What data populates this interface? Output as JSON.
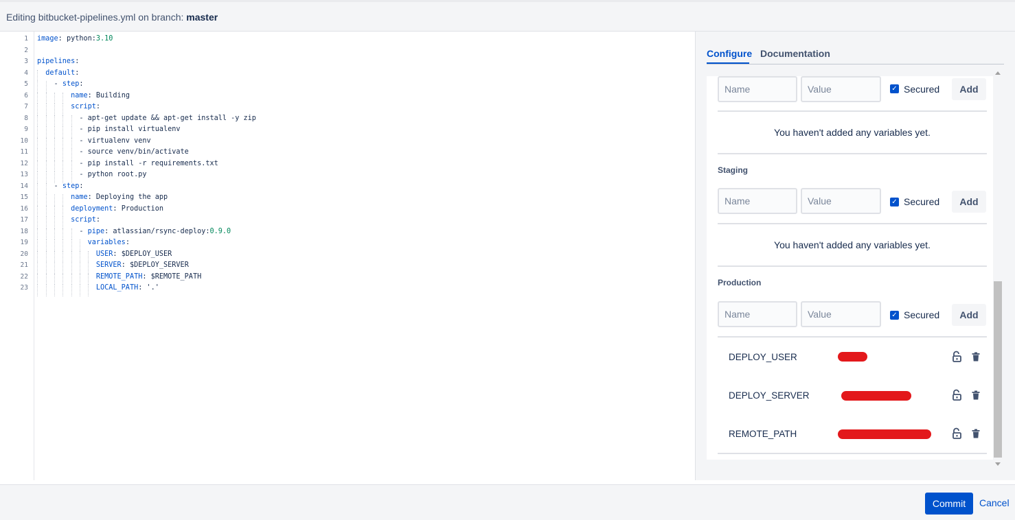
{
  "header": {
    "prefix": "Editing bitbucket-pipelines.yml on branch: ",
    "branch": "master"
  },
  "editor": {
    "lines": [
      "image: python:3.10",
      "",
      "pipelines:",
      "  default:",
      "    - step:",
      "        name: Building",
      "        script:",
      "          - apt-get update && apt-get install -y zip",
      "          - pip install virtualenv",
      "          - virtualenv venv",
      "          - source venv/bin/activate",
      "          - pip install -r requirements.txt",
      "          - python root.py",
      "    - step:",
      "        name: Deploying the app",
      "        deployment: Production",
      "        script:",
      "          - pipe: atlassian/rsync-deploy:0.9.0",
      "            variables:",
      "              USER: $DEPLOY_USER",
      "              SERVER: $DEPLOY_SERVER",
      "              REMOTE_PATH: $REMOTE_PATH",
      "              LOCAL_PATH: '.'"
    ]
  },
  "panel": {
    "tabs": {
      "configure": "Configure",
      "documentation": "Documentation"
    },
    "form": {
      "name_placeholder": "Name",
      "value_placeholder": "Value",
      "secured_label": "Secured",
      "add_label": "Add"
    },
    "empty_message": "You haven't added any variables yet.",
    "sections": {
      "staging": "Staging",
      "production": "Production"
    },
    "production_variables": [
      {
        "name": "DEPLOY_USER"
      },
      {
        "name": "DEPLOY_SERVER"
      },
      {
        "name": "REMOTE_PATH"
      }
    ]
  },
  "footer": {
    "commit": "Commit",
    "cancel": "Cancel"
  },
  "colors": {
    "accent": "#0052cc",
    "redaction": "#e3181b",
    "panel_bg": "#f4f5f7"
  }
}
